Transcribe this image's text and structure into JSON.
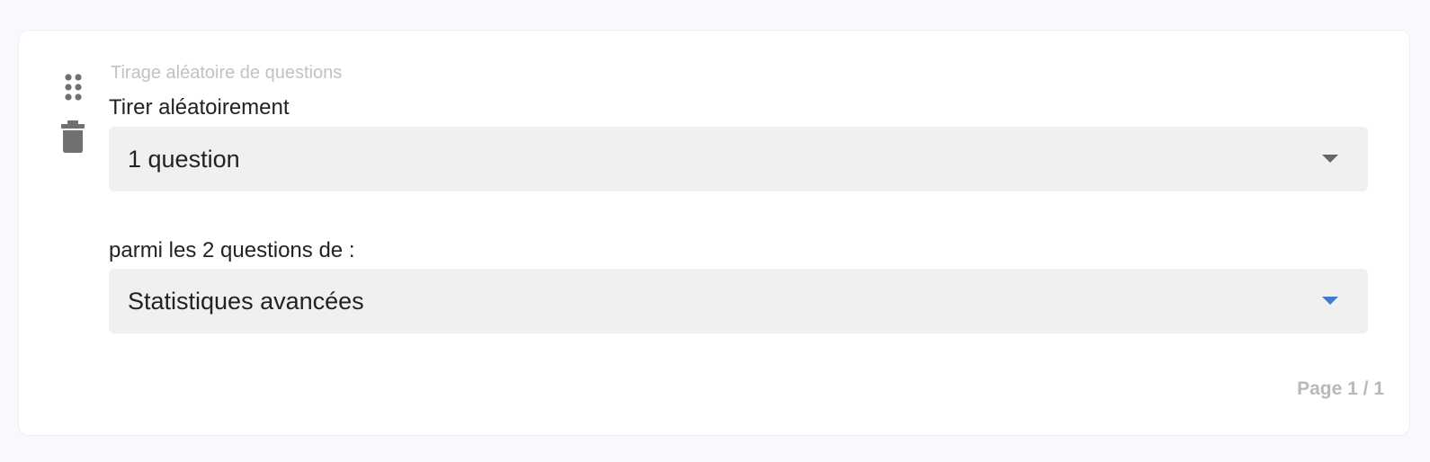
{
  "card": {
    "caption": "Tirage aléatoire de questions",
    "draw_label": "Tirer aléatoirement",
    "draw_select": {
      "value": "1 question"
    },
    "source_label": "parmi les 2 questions de :",
    "source_select": {
      "value": "Statistiques avancées"
    },
    "pagination": "Page 1 / 1"
  },
  "icons": {
    "drag": "drag-handle-icon",
    "delete": "trash-icon",
    "dropdown": "chevron-down-icon"
  },
  "colors": {
    "background": "#f8f9fd",
    "card": "#ffffff",
    "field_fill": "#f0f0f0",
    "accent": "#3c7dd1",
    "icon": "#707070"
  }
}
